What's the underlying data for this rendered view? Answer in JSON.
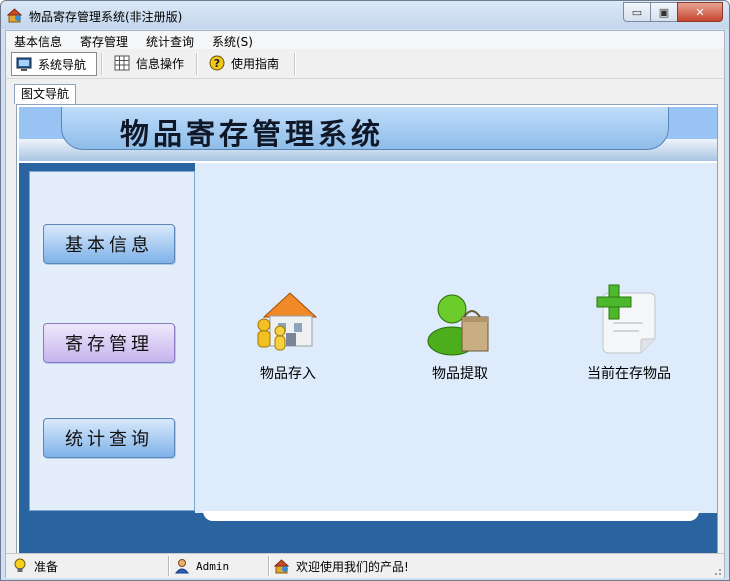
{
  "window": {
    "title": "物品寄存管理系统(非注册版)"
  },
  "window_buttons": {
    "minimize": "▭",
    "restore": "▣",
    "close": "✕"
  },
  "menubar": {
    "items": [
      "基本信息",
      "寄存管理",
      "统计查询",
      "系统(S)"
    ]
  },
  "toolbar": {
    "items": [
      {
        "label": "系统导航",
        "icon": "monitor-icon",
        "active": true
      },
      {
        "label": "信息操作",
        "icon": "grid-icon",
        "active": false
      },
      {
        "label": "使用指南",
        "icon": "help-icon",
        "active": false
      }
    ]
  },
  "tab": {
    "label": "图文导航"
  },
  "banner": {
    "title": "物品寄存管理系统"
  },
  "sidebar": {
    "buttons": [
      "基本信息",
      "寄存管理",
      "统计查询"
    ]
  },
  "features": [
    {
      "label": "物品存入",
      "icon": "house-people-icon"
    },
    {
      "label": "物品提取",
      "icon": "user-bag-icon"
    },
    {
      "label": "当前在存物品",
      "icon": "document-add-icon"
    }
  ],
  "statusbar": {
    "status": "准备",
    "user": "Admin",
    "message": "欢迎使用我们的产品!"
  },
  "colors": {
    "accent": "#2a64a0",
    "banner": "#99c3f2",
    "panel": "#deebfb"
  }
}
